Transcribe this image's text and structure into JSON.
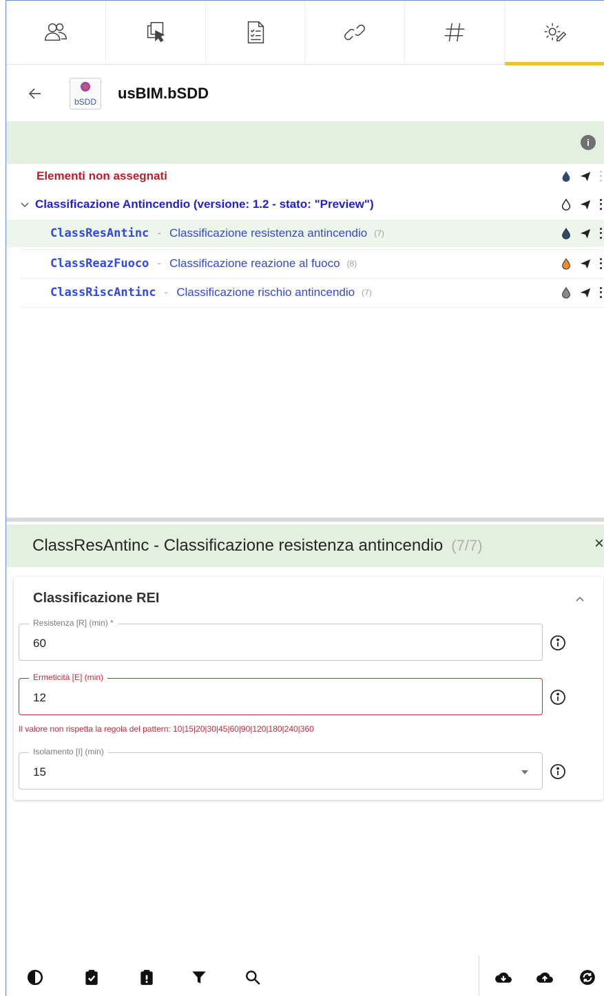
{
  "tabs": [
    {
      "icon": "users-icon"
    },
    {
      "icon": "select-element-icon"
    },
    {
      "icon": "checklist-document-icon"
    },
    {
      "icon": "link-icon"
    },
    {
      "icon": "hash-icon"
    },
    {
      "icon": "gear-pencil-icon",
      "active": true
    }
  ],
  "header": {
    "title": "usBIM.bSDD",
    "logo_text": "bSDD"
  },
  "tree": {
    "unassigned": "Elementi non assegnati",
    "root": "Classificazione Antincendio (versione: 1.2 - stato: \"Preview\")",
    "items": [
      {
        "code": "ClassResAntinc",
        "separator": "-",
        "description": "Classificazione resistenza antincendio",
        "count": "(7)",
        "drop_color": "#2f4a6e"
      },
      {
        "code": "ClassReazFuoco",
        "separator": "-",
        "description": "Classificazione reazione al fuoco",
        "count": "(8)",
        "drop_color": "#f08a2a"
      },
      {
        "code": "ClassRiscAntinc",
        "separator": "-",
        "description": "Classificazione rischio antincendio",
        "count": "(7)",
        "drop_color": "#777777"
      }
    ]
  },
  "detail": {
    "title": "ClassResAntinc - Classificazione resistenza antincendio",
    "count": "(7/7)",
    "close": "×",
    "group_title": "Classificazione REI",
    "fields": [
      {
        "label": "Resistenza [R] (min) *",
        "value": "60",
        "error": false
      },
      {
        "label": "Ermeticità [E] (min)",
        "value": "12",
        "error": true
      },
      {
        "label": "Isolamento [I] (min)",
        "value": "15",
        "error": false,
        "dropdown": true
      }
    ],
    "error_message": "Il valore non rispetta la regola del pattern: 10|15|20|30|45|60|90|120|180|240|360"
  },
  "toolbar": {
    "left": [
      "contrast-icon",
      "clipboard-check-icon",
      "clipboard-alert-icon",
      "filter-icon",
      "search-icon"
    ],
    "right": [
      "cloud-download-icon",
      "cloud-upload-icon",
      "sync-icon"
    ]
  }
}
